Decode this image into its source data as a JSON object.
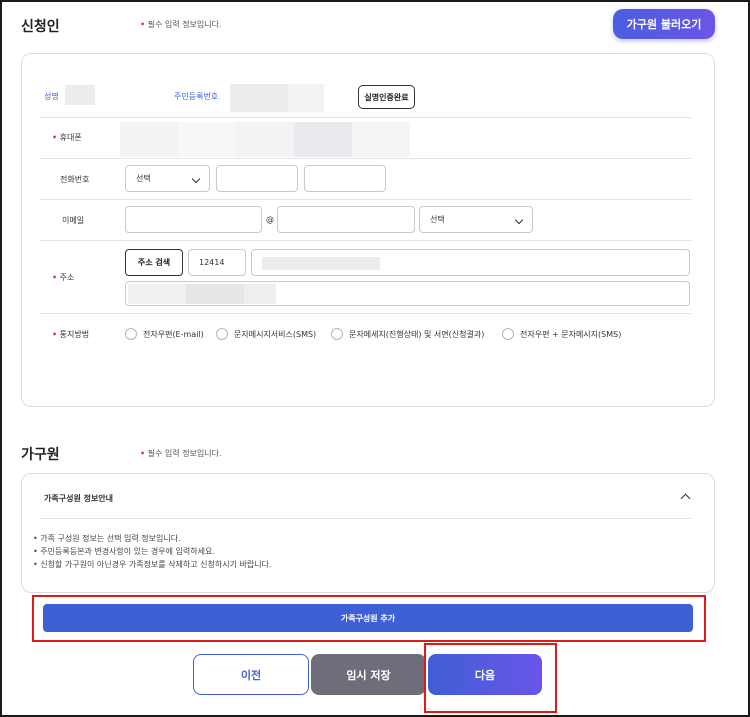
{
  "applicant": {
    "title": "신청인",
    "required_note": "필수 입력 정보입니다.",
    "load_family_button": "가구원 불러오기",
    "name_label": "성명",
    "rrn_label": "주민등록번호",
    "verified_button": "실명인증완료",
    "mobile_label": "휴대폰",
    "phone_label": "전화번호",
    "phone_area_select": "선택",
    "email_label": "이메일",
    "email_at": "@",
    "email_domain_select": "선택",
    "address_label": "주소",
    "address_search_button": "주소 검색",
    "postal_code": "12414",
    "notify_label": "통지방법",
    "notify_options": [
      "전자우편(E-mail)",
      "문자메시지서비스(SMS)",
      "문자메세지(진행상태) 및 서면(신청결과)",
      "전자우편 + 문자메시지(SMS)"
    ]
  },
  "household": {
    "title": "가구원",
    "required_note": "필수 입력 정보입니다.",
    "info_title": "가족구성원 정보안내",
    "info_items": [
      "가족 구성원 정보는 선택 입력 정보입니다.",
      "주민등록등본과 변경사항이 있는 경우에 입력하세요.",
      "신청할 가구원이 아닌경우 가족정보를 삭제하고 신청하시기 바랍니다."
    ],
    "add_member_button": "가족구성원 추가"
  },
  "footer": {
    "prev_button": "이전",
    "temp_save_button": "임시 저장",
    "next_button": "다음"
  }
}
